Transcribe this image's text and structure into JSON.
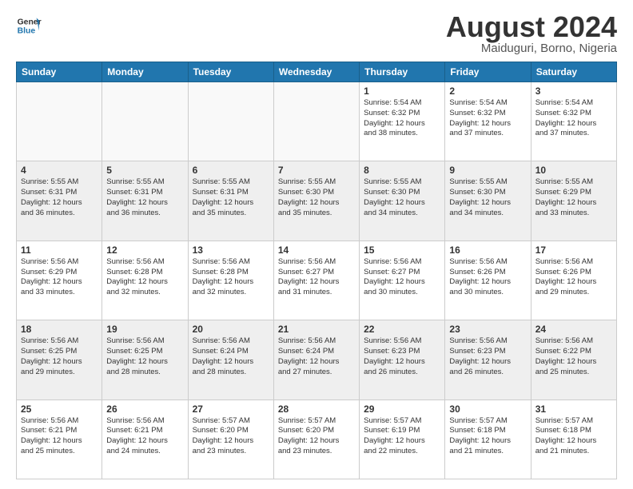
{
  "header": {
    "logo_line1": "General",
    "logo_line2": "Blue",
    "month": "August 2024",
    "location": "Maiduguri, Borno, Nigeria"
  },
  "days_of_week": [
    "Sunday",
    "Monday",
    "Tuesday",
    "Wednesday",
    "Thursday",
    "Friday",
    "Saturday"
  ],
  "weeks": [
    [
      {
        "day": "",
        "info": ""
      },
      {
        "day": "",
        "info": ""
      },
      {
        "day": "",
        "info": ""
      },
      {
        "day": "",
        "info": ""
      },
      {
        "day": "1",
        "info": "Sunrise: 5:54 AM\nSunset: 6:32 PM\nDaylight: 12 hours\nand 38 minutes."
      },
      {
        "day": "2",
        "info": "Sunrise: 5:54 AM\nSunset: 6:32 PM\nDaylight: 12 hours\nand 37 minutes."
      },
      {
        "day": "3",
        "info": "Sunrise: 5:54 AM\nSunset: 6:32 PM\nDaylight: 12 hours\nand 37 minutes."
      }
    ],
    [
      {
        "day": "4",
        "info": "Sunrise: 5:55 AM\nSunset: 6:31 PM\nDaylight: 12 hours\nand 36 minutes."
      },
      {
        "day": "5",
        "info": "Sunrise: 5:55 AM\nSunset: 6:31 PM\nDaylight: 12 hours\nand 36 minutes."
      },
      {
        "day": "6",
        "info": "Sunrise: 5:55 AM\nSunset: 6:31 PM\nDaylight: 12 hours\nand 35 minutes."
      },
      {
        "day": "7",
        "info": "Sunrise: 5:55 AM\nSunset: 6:30 PM\nDaylight: 12 hours\nand 35 minutes."
      },
      {
        "day": "8",
        "info": "Sunrise: 5:55 AM\nSunset: 6:30 PM\nDaylight: 12 hours\nand 34 minutes."
      },
      {
        "day": "9",
        "info": "Sunrise: 5:55 AM\nSunset: 6:30 PM\nDaylight: 12 hours\nand 34 minutes."
      },
      {
        "day": "10",
        "info": "Sunrise: 5:55 AM\nSunset: 6:29 PM\nDaylight: 12 hours\nand 33 minutes."
      }
    ],
    [
      {
        "day": "11",
        "info": "Sunrise: 5:56 AM\nSunset: 6:29 PM\nDaylight: 12 hours\nand 33 minutes."
      },
      {
        "day": "12",
        "info": "Sunrise: 5:56 AM\nSunset: 6:28 PM\nDaylight: 12 hours\nand 32 minutes."
      },
      {
        "day": "13",
        "info": "Sunrise: 5:56 AM\nSunset: 6:28 PM\nDaylight: 12 hours\nand 32 minutes."
      },
      {
        "day": "14",
        "info": "Sunrise: 5:56 AM\nSunset: 6:27 PM\nDaylight: 12 hours\nand 31 minutes."
      },
      {
        "day": "15",
        "info": "Sunrise: 5:56 AM\nSunset: 6:27 PM\nDaylight: 12 hours\nand 30 minutes."
      },
      {
        "day": "16",
        "info": "Sunrise: 5:56 AM\nSunset: 6:26 PM\nDaylight: 12 hours\nand 30 minutes."
      },
      {
        "day": "17",
        "info": "Sunrise: 5:56 AM\nSunset: 6:26 PM\nDaylight: 12 hours\nand 29 minutes."
      }
    ],
    [
      {
        "day": "18",
        "info": "Sunrise: 5:56 AM\nSunset: 6:25 PM\nDaylight: 12 hours\nand 29 minutes."
      },
      {
        "day": "19",
        "info": "Sunrise: 5:56 AM\nSunset: 6:25 PM\nDaylight: 12 hours\nand 28 minutes."
      },
      {
        "day": "20",
        "info": "Sunrise: 5:56 AM\nSunset: 6:24 PM\nDaylight: 12 hours\nand 28 minutes."
      },
      {
        "day": "21",
        "info": "Sunrise: 5:56 AM\nSunset: 6:24 PM\nDaylight: 12 hours\nand 27 minutes."
      },
      {
        "day": "22",
        "info": "Sunrise: 5:56 AM\nSunset: 6:23 PM\nDaylight: 12 hours\nand 26 minutes."
      },
      {
        "day": "23",
        "info": "Sunrise: 5:56 AM\nSunset: 6:23 PM\nDaylight: 12 hours\nand 26 minutes."
      },
      {
        "day": "24",
        "info": "Sunrise: 5:56 AM\nSunset: 6:22 PM\nDaylight: 12 hours\nand 25 minutes."
      }
    ],
    [
      {
        "day": "25",
        "info": "Sunrise: 5:56 AM\nSunset: 6:21 PM\nDaylight: 12 hours\nand 25 minutes."
      },
      {
        "day": "26",
        "info": "Sunrise: 5:56 AM\nSunset: 6:21 PM\nDaylight: 12 hours\nand 24 minutes."
      },
      {
        "day": "27",
        "info": "Sunrise: 5:57 AM\nSunset: 6:20 PM\nDaylight: 12 hours\nand 23 minutes."
      },
      {
        "day": "28",
        "info": "Sunrise: 5:57 AM\nSunset: 6:20 PM\nDaylight: 12 hours\nand 23 minutes."
      },
      {
        "day": "29",
        "info": "Sunrise: 5:57 AM\nSunset: 6:19 PM\nDaylight: 12 hours\nand 22 minutes."
      },
      {
        "day": "30",
        "info": "Sunrise: 5:57 AM\nSunset: 6:18 PM\nDaylight: 12 hours\nand 21 minutes."
      },
      {
        "day": "31",
        "info": "Sunrise: 5:57 AM\nSunset: 6:18 PM\nDaylight: 12 hours\nand 21 minutes."
      }
    ]
  ]
}
